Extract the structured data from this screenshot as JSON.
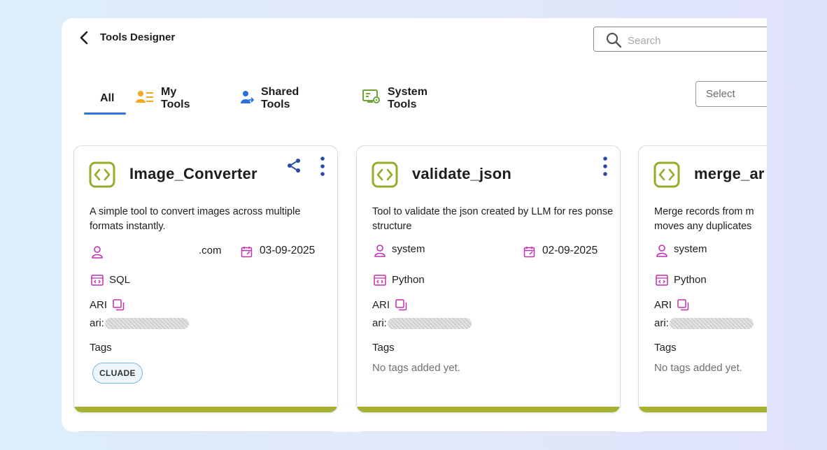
{
  "header": {
    "title": "Tools Designer",
    "search_placeholder": "Search"
  },
  "tabs": [
    {
      "label": "All",
      "active": true
    },
    {
      "label": "My Tools",
      "icon": "user-list-icon"
    },
    {
      "label": "Shared Tools",
      "icon": "shared-user-icon"
    },
    {
      "label": "System Tools",
      "icon": "system-gear-icon"
    }
  ],
  "filter": {
    "placeholder": "Select"
  },
  "colors": {
    "accent": "#2f73d8",
    "card_bar": "#a6b22f",
    "code_icon": "#9aaa2b",
    "meta_icon": "#c02fb2",
    "my_tools_icon": "#f5a623",
    "shared_icon": "#2a6fdb",
    "system_icon": "#6ea53a"
  },
  "cards": [
    {
      "title": "Image_Converter",
      "description": "A simple tool to convert images across multiple formats instantly.",
      "user": ".com",
      "date": "03-09-2025",
      "language": "SQL",
      "ari_label": "ARI",
      "ari_prefix": "ari:",
      "tags_label": "Tags",
      "tag": "CLUADE",
      "shared": true
    },
    {
      "title": "validate_json",
      "description": "Tool to validate the json created by LLM for res ponse structure",
      "user": "system",
      "date": "02-09-2025",
      "language": "Python",
      "ari_label": "ARI",
      "ari_prefix": "ari:",
      "tags_label": "Tags",
      "no_tags": "No tags added yet."
    },
    {
      "title": "merge_ar",
      "description": "Merge records from m moves any duplicates",
      "user": "system",
      "language": "Python",
      "ari_label": "ARI",
      "ari_prefix": "ari:",
      "tags_label": "Tags",
      "no_tags": "No tags added yet."
    }
  ]
}
